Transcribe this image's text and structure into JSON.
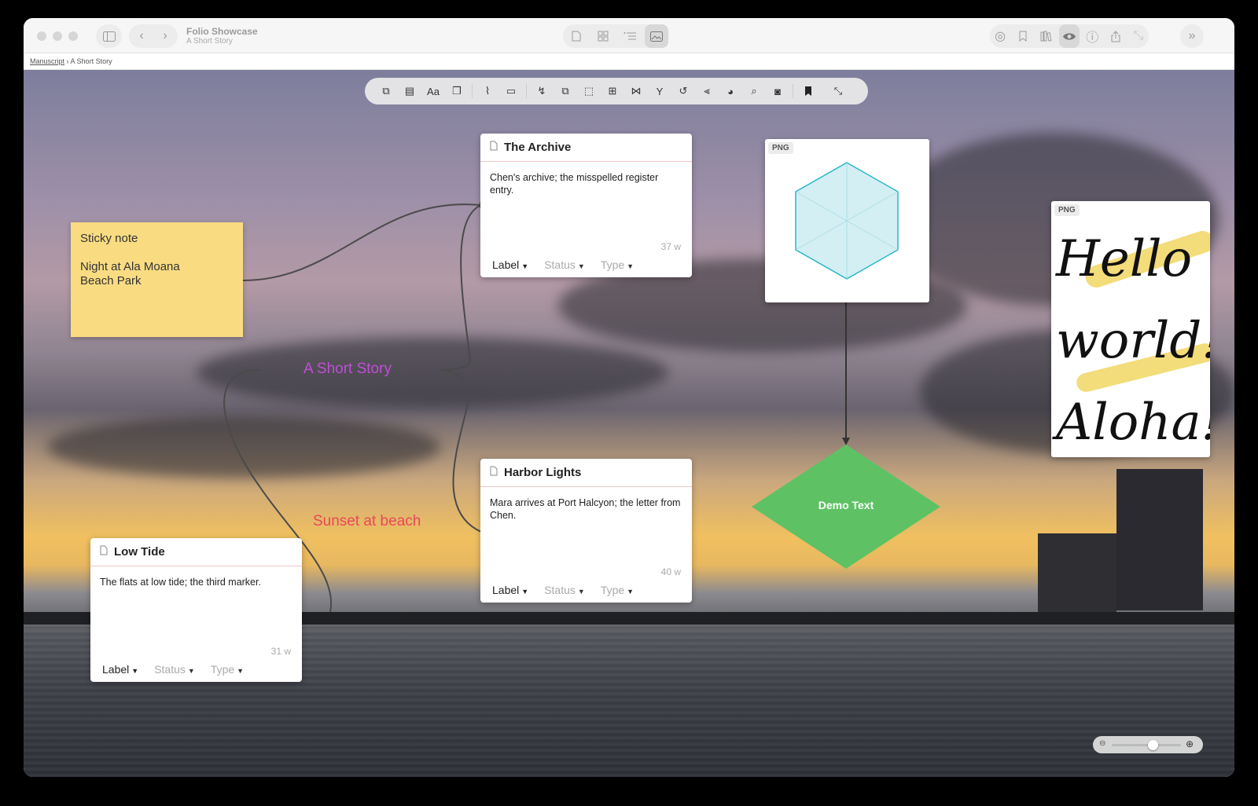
{
  "window": {
    "title": "Folio Showcase",
    "subtitle": "A Short Story"
  },
  "titlebar_icons": {
    "left": [
      "sidebar-icon",
      "back-icon",
      "forward-icon"
    ],
    "view_modes": [
      "document-icon",
      "grid-icon",
      "outline-icon",
      "canvas-icon"
    ],
    "right": [
      "target-icon",
      "bookmark-icon",
      "library-icon",
      "eye-icon",
      "info-icon",
      "share-icon",
      "expand-icon",
      "chevrons-right-icon"
    ]
  },
  "breadcrumb": {
    "root": "Manuscript",
    "separator": "›",
    "current": "A Short Story"
  },
  "sticky": {
    "line1": "Sticky note",
    "line2": "Night at Ala Moana",
    "line3": "Beach Park"
  },
  "cards": {
    "archive": {
      "title": "The Archive",
      "body": "Chen's archive; the misspelled register entry.",
      "word_count": "37 w",
      "label": "Label",
      "status": "Status",
      "type": "Type"
    },
    "harbor": {
      "title": "Harbor Lights",
      "body": "Mara arrives at Port Halcyon; the letter from Chen.",
      "word_count": "40 w",
      "label": "Label",
      "status": "Status",
      "type": "Type"
    },
    "lowtide": {
      "title": "Low Tide",
      "body": "The flats at low tide; the third marker.",
      "word_count": "31 w",
      "label": "Label",
      "status": "Status",
      "type": "Type"
    }
  },
  "png_badge": "PNG",
  "handwriting": [
    "Hello",
    "world!",
    "Aloha!"
  ],
  "canvas_text": {
    "short_story": "A Short Story",
    "sunset": "Sunset at beach",
    "diamond": "Demo Text"
  },
  "colors": {
    "sticky": "#f9dc82",
    "diamond": "#5ec264",
    "short_story_text": "#c04fd6",
    "sunset_text": "#e8475a",
    "hexagon_stroke": "#2bb7c8"
  }
}
